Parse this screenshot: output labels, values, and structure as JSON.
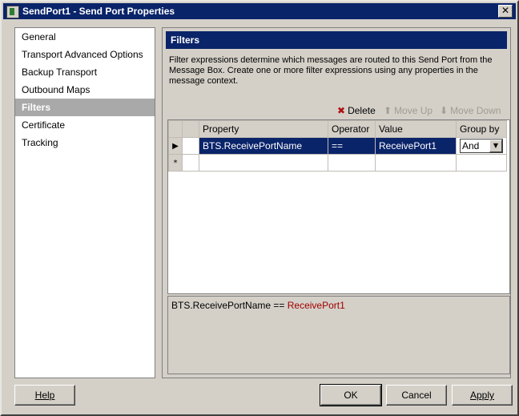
{
  "window": {
    "title": "SendPort1 - Send Port Properties"
  },
  "nav": {
    "items": [
      {
        "label": "General"
      },
      {
        "label": "Transport Advanced Options"
      },
      {
        "label": "Backup Transport"
      },
      {
        "label": "Outbound Maps"
      },
      {
        "label": "Filters",
        "selected": true
      },
      {
        "label": "Certificate"
      },
      {
        "label": "Tracking"
      }
    ]
  },
  "panel": {
    "header": "Filters",
    "description": "Filter expressions determine which messages are routed to this Send Port from the Message Box. Create one or more filter expressions using any properties in the message context."
  },
  "toolbar": {
    "delete_label": "Delete",
    "move_up_label": "Move Up",
    "move_down_label": "Move Down"
  },
  "grid": {
    "columns": [
      "Property",
      "Operator",
      "Value",
      "Group by"
    ],
    "rows": [
      {
        "property": "BTS.ReceivePortName",
        "operator": "==",
        "value": "ReceivePort1",
        "group_by": "And"
      }
    ],
    "new_row_marker": "*"
  },
  "expression": {
    "text": "BTS.ReceivePortName ==",
    "value": "ReceivePort1"
  },
  "buttons": {
    "help": "Help",
    "ok": "OK",
    "cancel": "Cancel",
    "apply": "Apply"
  },
  "colors": {
    "title_bar": "#0a246a",
    "selection": "#0a246a",
    "value_highlight": "#a00000"
  }
}
